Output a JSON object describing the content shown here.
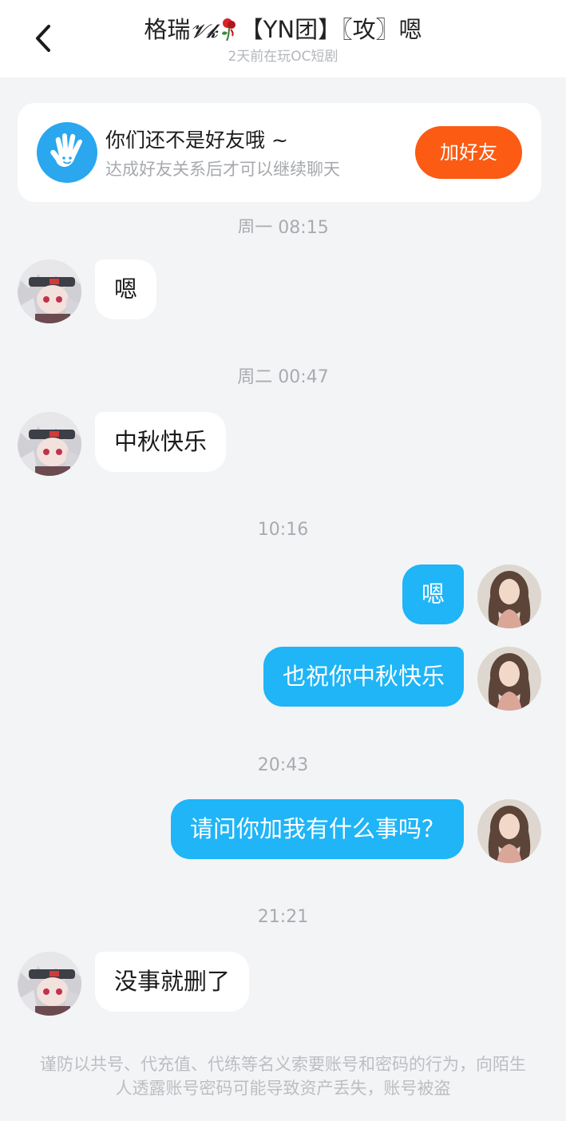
{
  "header": {
    "title_left": "格瑞",
    "title_right": "【YN团】〖攻〗嗯",
    "status": "2天前在玩OC短剧",
    "colors": {
      "background": "#ffffff",
      "title": "#222222",
      "status": "#b3b6bc"
    }
  },
  "notice": {
    "title": "你们还不是好友哦 ~",
    "subtitle": "达成好友关系后才可以继续聊天",
    "add_button": "加好友",
    "icon": "hand-icon",
    "colors": {
      "icon_bg": "#2aa7ee",
      "button": "#fb5b13"
    }
  },
  "messages": {
    "cut_timestamp": "周一 08:15",
    "m1": {
      "text": "嗯",
      "sender": "them"
    },
    "ts2": "周二 00:47",
    "m2": {
      "text": "中秋快乐",
      "sender": "them"
    },
    "ts3": "10:16",
    "m3": {
      "text": "嗯",
      "sender": "me"
    },
    "m4": {
      "text": "也祝你中秋快乐",
      "sender": "me"
    },
    "ts4": "20:43",
    "m5": {
      "text": "请问你加我有什么事吗？",
      "sender": "me"
    },
    "ts5": "21:21",
    "m6": {
      "text": "没事就删了",
      "sender": "them"
    }
  },
  "footer": {
    "warning": "谨防以共号、代充值、代练等名义索要账号和密码的行为，向陌生人透露账号密码可能导致资产丢失，账号被盗"
  },
  "colors": {
    "page_bg": "#f3f4f6",
    "outgoing_bubble": "#1fb5f7",
    "incoming_bubble": "#ffffff"
  }
}
